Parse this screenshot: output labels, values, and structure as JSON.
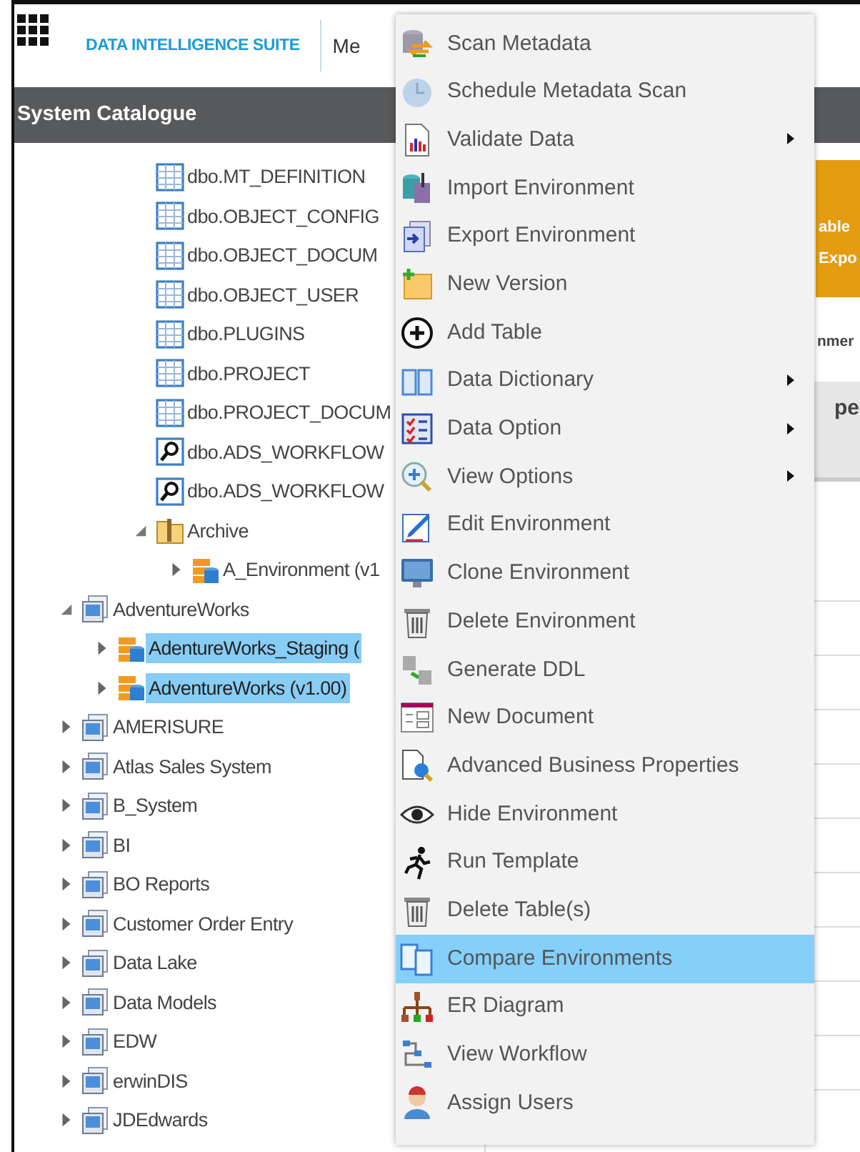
{
  "header": {
    "product": "DATA INTELLIGENCE SUITE",
    "nav_item": "Me"
  },
  "panel": {
    "title": "System Catalogue"
  },
  "tree": {
    "scrolled_branch": [
      {
        "label": "dbo.MT_DEFINITION",
        "kind": "table",
        "selected": false
      },
      {
        "label": "dbo.OBJECT_CONFIG",
        "kind": "table",
        "selected": false
      },
      {
        "label": "dbo.OBJECT_DOCUM",
        "kind": "table",
        "selected": false
      },
      {
        "label": "dbo.OBJECT_USER",
        "kind": "table",
        "selected": false
      },
      {
        "label": "dbo.PLUGINS",
        "kind": "table",
        "selected": false
      },
      {
        "label": "dbo.PROJECT",
        "kind": "table",
        "selected": false
      },
      {
        "label": "dbo.PROJECT_DOCUM",
        "kind": "table",
        "selected": false
      },
      {
        "label": "dbo.ADS_WORKFLOW",
        "kind": "view",
        "selected": false
      },
      {
        "label": "dbo.ADS_WORKFLOW",
        "kind": "view",
        "selected": false
      },
      {
        "label": "Archive",
        "kind": "folder",
        "expanded": true,
        "selected": false,
        "children": [
          {
            "label": "A_Environment (v1",
            "kind": "environment",
            "expanded": false,
            "selected": false
          }
        ]
      }
    ],
    "items": [
      {
        "label": "AdventureWorks",
        "kind": "system",
        "expanded": true,
        "selected": false,
        "children": [
          {
            "label": "AdentureWorks_Staging (",
            "kind": "environment",
            "expanded": false,
            "selected": true
          },
          {
            "label": "AdventureWorks (v1.00)",
            "kind": "environment",
            "expanded": false,
            "selected": true
          }
        ]
      },
      {
        "label": "AMERISURE",
        "kind": "system",
        "expanded": false,
        "selected": false
      },
      {
        "label": "Atlas Sales System",
        "kind": "system",
        "expanded": false,
        "selected": false
      },
      {
        "label": "B_System",
        "kind": "system",
        "expanded": false,
        "selected": false
      },
      {
        "label": "BI",
        "kind": "system",
        "expanded": false,
        "selected": false
      },
      {
        "label": "BO Reports",
        "kind": "system",
        "expanded": false,
        "selected": false
      },
      {
        "label": "Customer Order Entry",
        "kind": "system",
        "expanded": false,
        "selected": false
      },
      {
        "label": "Data Lake",
        "kind": "system",
        "expanded": false,
        "selected": false
      },
      {
        "label": "Data Models",
        "kind": "system",
        "expanded": false,
        "selected": false
      },
      {
        "label": "EDW",
        "kind": "system",
        "expanded": false,
        "selected": false
      },
      {
        "label": "erwinDIS",
        "kind": "system",
        "expanded": false,
        "selected": false
      },
      {
        "label": "JDEdwards",
        "kind": "system",
        "expanded": false,
        "selected": false
      }
    ]
  },
  "background_panel": {
    "banner_lines": [
      "able",
      "Expo"
    ],
    "section_label": "nmer",
    "column_header": "pe"
  },
  "context_menu": [
    {
      "label": "Scan Metadata",
      "submenu": false,
      "selected": false
    },
    {
      "label": "Schedule Metadata Scan",
      "submenu": false,
      "selected": false
    },
    {
      "label": "Validate Data",
      "submenu": true,
      "selected": false
    },
    {
      "label": "Import Environment",
      "submenu": false,
      "selected": false
    },
    {
      "label": "Export Environment",
      "submenu": false,
      "selected": false
    },
    {
      "label": "New Version",
      "submenu": false,
      "selected": false
    },
    {
      "label": "Add Table",
      "submenu": false,
      "selected": false
    },
    {
      "label": "Data Dictionary",
      "submenu": true,
      "selected": false
    },
    {
      "label": "Data Option",
      "submenu": true,
      "selected": false
    },
    {
      "label": "View Options",
      "submenu": true,
      "selected": false
    },
    {
      "label": "Edit Environment",
      "submenu": false,
      "selected": false
    },
    {
      "label": "Clone Environment",
      "submenu": false,
      "selected": false
    },
    {
      "label": "Delete Environment",
      "submenu": false,
      "selected": false
    },
    {
      "label": "Generate DDL",
      "submenu": false,
      "selected": false
    },
    {
      "label": "New Document",
      "submenu": false,
      "selected": false
    },
    {
      "label": "Advanced Business Properties",
      "submenu": false,
      "selected": false
    },
    {
      "label": "Hide Environment",
      "submenu": false,
      "selected": false
    },
    {
      "label": "Run Template",
      "submenu": false,
      "selected": false
    },
    {
      "label": "Delete Table(s)",
      "submenu": false,
      "selected": false
    },
    {
      "label": "Compare Environments",
      "submenu": false,
      "selected": true
    },
    {
      "label": "ER Diagram",
      "submenu": false,
      "selected": false
    },
    {
      "label": "View Workflow",
      "submenu": false,
      "selected": false
    },
    {
      "label": "Assign Users",
      "submenu": false,
      "selected": false
    }
  ]
}
